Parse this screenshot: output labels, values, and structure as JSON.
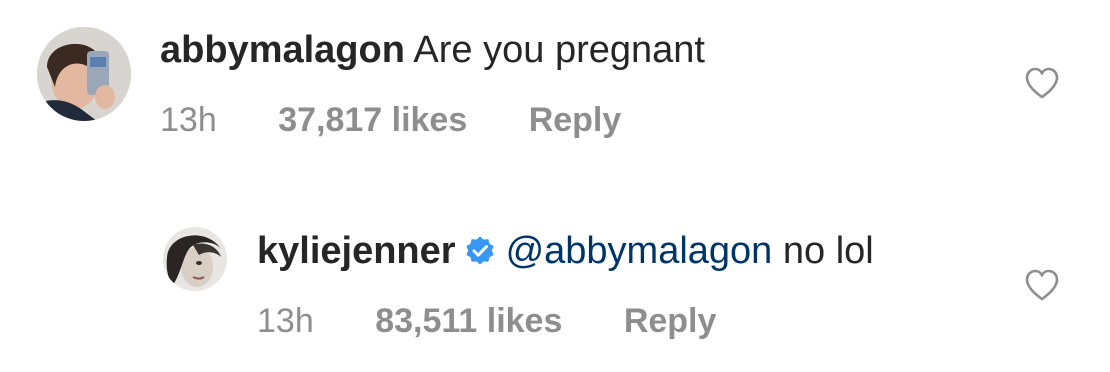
{
  "comments": [
    {
      "username": "abbymalagon",
      "text": "Are you pregnant",
      "time": "13h",
      "likes": "37,817 likes",
      "reply_label": "Reply",
      "verified": false,
      "avatar_icon": "profile-photo-selfie"
    },
    {
      "username": "kyliejenner",
      "mention": "@abbymalagon",
      "text": "no lol",
      "time": "13h",
      "likes": "83,511 likes",
      "reply_label": "Reply",
      "verified": true,
      "avatar_icon": "profile-photo-portrait"
    }
  ],
  "colors": {
    "username": "#262626",
    "meta": "#8e8e8e",
    "mention": "#003569",
    "verified_badge": "#3897f0",
    "heart_outline": "#8e8e8e"
  },
  "icons": {
    "like": "heart-outline-icon",
    "verified": "verified-badge-icon"
  }
}
